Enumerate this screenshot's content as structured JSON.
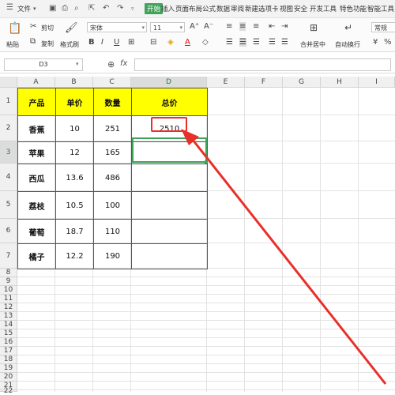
{
  "menubar": {
    "file": "文件",
    "tabs": [
      "开始",
      "插入",
      "页面布局",
      "公式",
      "数据",
      "审阅",
      "新建选项卡",
      "视图",
      "安全",
      "开发工具",
      "特色功能",
      "智能工具"
    ]
  },
  "ribbon": {
    "paste": "粘贴",
    "cut": "剪切",
    "copy": "复制",
    "format_painter": "格式刷",
    "font_name": "宋体",
    "font_size": "11",
    "merge_center": "合并居中",
    "auto_wrap": "自动换行",
    "number_format": "常规"
  },
  "formula_bar": {
    "name_box": "D3",
    "fx": "fx",
    "value": ""
  },
  "columns": [
    "A",
    "B",
    "C",
    "D",
    "E",
    "F",
    "G",
    "H",
    "I"
  ],
  "rows": [
    "1",
    "2",
    "3",
    "4",
    "5",
    "6",
    "7",
    "8",
    "9",
    "10",
    "11",
    "12",
    "13",
    "14",
    "15",
    "16",
    "17",
    "18",
    "19",
    "20",
    "21",
    "22"
  ],
  "table": {
    "headers": [
      "产品",
      "单价",
      "数量",
      "总价"
    ],
    "rows": [
      [
        "香蕉",
        "10",
        "251",
        "2510"
      ],
      [
        "苹果",
        "12",
        "165",
        ""
      ],
      [
        "西瓜",
        "13.6",
        "486",
        ""
      ],
      [
        "荔枝",
        "10.5",
        "100",
        ""
      ],
      [
        "葡萄",
        "18.7",
        "110",
        ""
      ],
      [
        "橘子",
        "12.2",
        "190",
        ""
      ]
    ]
  },
  "colors": {
    "header_fill": "#ffff00",
    "active_tab": "#3fa35a",
    "selection": "#2a7a3e",
    "annotation": "#e8302a"
  }
}
